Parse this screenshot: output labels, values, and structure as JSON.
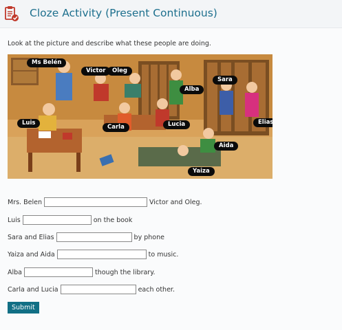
{
  "header": {
    "title": "Cloze Activity (Present Continuous)",
    "icon": "clipboard-check-icon",
    "accent": "#1d6f8d"
  },
  "instruction": "Look at the picture and describe what these people are doing.",
  "picture": {
    "labels": {
      "ms_belen": "Ms Belén",
      "victor": "Victor",
      "oleg": "Oleg",
      "alba": "Alba",
      "sara": "Sara",
      "luis": "Luis",
      "carla": "Carla",
      "lucia": "Lucia",
      "elias": "Elias",
      "aida": "Aida",
      "yaiza": "Yaiza"
    }
  },
  "exercise": [
    {
      "before": "Mrs. Belen",
      "after": "Victor and Oleg.",
      "value": ""
    },
    {
      "before": "Luis",
      "after": "on the book",
      "value": ""
    },
    {
      "before": "Sara and Elias",
      "after": "by phone",
      "value": ""
    },
    {
      "before": "Yaiza and Aida",
      "after": "to music.",
      "value": ""
    },
    {
      "before": "Alba",
      "after": "though the library.",
      "value": ""
    },
    {
      "before": "Carla and Lucia",
      "after": "each other.",
      "value": ""
    }
  ],
  "submit_label": "Submit",
  "submit_color": "#116f85"
}
